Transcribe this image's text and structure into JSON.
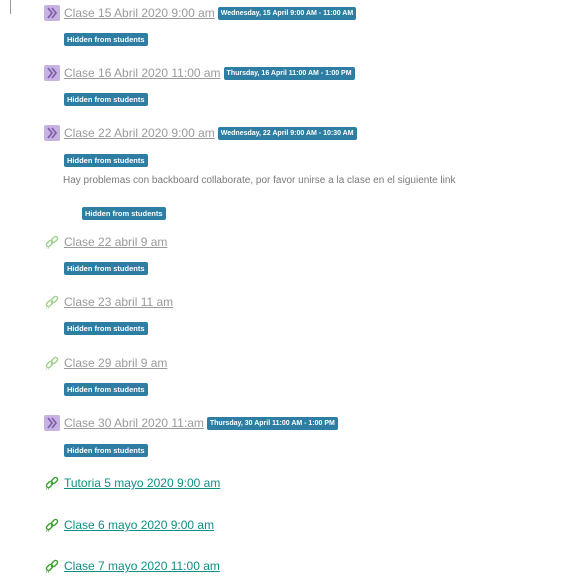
{
  "items": [
    {
      "icon": "bigbluebutton-icon",
      "title": "Clase 15 Abril 2020 9:00 am",
      "date": "Wednesday, 15 April 9:00 AM - 11:00 AM",
      "hidden": "Hidden from students",
      "visible": false
    },
    {
      "icon": "bigbluebutton-icon",
      "title": "Clase 16 Abril 2020 11:00 am",
      "date": "Thursday, 16 April 11:00 AM - 1:00 PM",
      "hidden": "Hidden from students",
      "visible": false
    },
    {
      "icon": "bigbluebutton-icon",
      "title": "Clase 22 Abril 2020 9:00 am",
      "date": "Wednesday, 22 April 9:00 AM - 10:30 AM",
      "hidden": "Hidden from students",
      "visible": false
    },
    {
      "icon": "link-icon",
      "title": "Clase 22 abril 9 am",
      "hidden": "Hidden from students",
      "visible": false
    },
    {
      "icon": "link-icon",
      "title": "Clase 23 abril 11 am",
      "hidden": "Hidden from students",
      "visible": false
    },
    {
      "icon": "link-icon",
      "title": "Clase 29 abril 9 am",
      "hidden": "Hidden from students",
      "visible": false
    },
    {
      "icon": "bigbluebutton-icon",
      "title": "Clase 30 Abril 2020 11:am",
      "date": "Thursday, 30 April 11:00 AM - 1:00 PM",
      "hidden": "Hidden from students",
      "visible": false
    },
    {
      "icon": "link-icon",
      "title": "Tutoria 5 mayo 2020 9:00 am",
      "visible": true
    },
    {
      "icon": "link-icon",
      "title": "Clase 6 mayo 2020 9:00 am",
      "visible": true
    },
    {
      "icon": "link-icon",
      "title": "Clase 7 mayo 2020 11:00 am",
      "visible": true
    }
  ],
  "label_note": {
    "text": "Hay problemas con backboard collaborate, por favor unirse a la clase en el siguiente link",
    "hidden": "Hidden from students"
  },
  "colors": {
    "badge": "#2e7ea3",
    "hidden_link": "#9a9a9a",
    "visible_link": "#0f8f85",
    "bbb_icon": "#b79fd6",
    "link_icon_visible": "#3ca12f",
    "link_icon_hidden": "#9fd08f"
  }
}
